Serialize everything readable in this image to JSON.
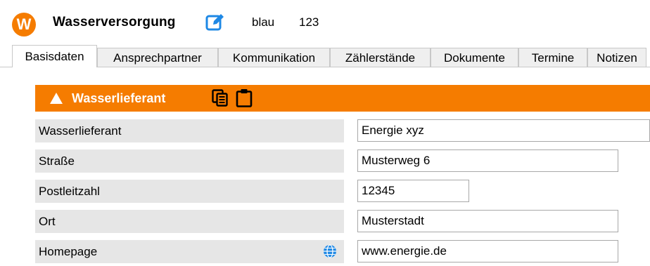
{
  "header": {
    "logo_letter": "W",
    "title": "Wasserversorgung",
    "edit_icon": "edit-icon",
    "meta_color": "blau",
    "meta_number": "123",
    "accent": "#f57c00"
  },
  "tabs": [
    {
      "label": "Basisdaten",
      "active": true
    },
    {
      "label": "Ansprechpartner",
      "active": false
    },
    {
      "label": "Kommunikation",
      "active": false
    },
    {
      "label": "Zählerstände",
      "active": false
    },
    {
      "label": "Dokumente",
      "active": false
    },
    {
      "label": "Termine",
      "active": false
    },
    {
      "label": "Notizen",
      "active": false
    }
  ],
  "section": {
    "title": "Wasserlieferant",
    "icons": [
      "collapse-triangle-icon",
      "copy-icon",
      "clipboard-icon"
    ]
  },
  "fields": [
    {
      "label": "Wasserlieferant",
      "value": "Energie xyz"
    },
    {
      "label": "Straße",
      "value": "Musterweg 6"
    },
    {
      "label": "Postleitzahl",
      "value": "12345"
    },
    {
      "label": "Ort",
      "value": "Musterstadt"
    },
    {
      "label": "Homepage",
      "value": "www.energie.de",
      "icon": "globe-icon"
    }
  ]
}
